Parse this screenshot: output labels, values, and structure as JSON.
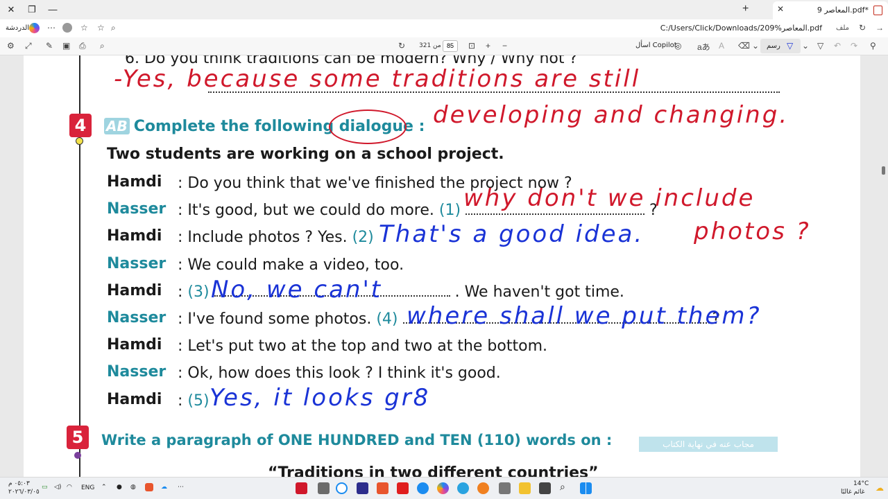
{
  "browser": {
    "tab_title": "المعاصر 9.pdf*",
    "address_label": "ملف",
    "url": "C:/Users/Click/Downloads/209%المعاصر.pdf",
    "chat_label": "الدردشة"
  },
  "pdf_toolbar": {
    "page_number": "85",
    "page_of": "من 321",
    "copilot_label": "اسأل Copilot",
    "draw_label": "رسم"
  },
  "document": {
    "top_question": "6. Do you think traditions can be modern? Why / Why not ?",
    "section4": {
      "number": "4",
      "ab_label": "AB",
      "heading": "Complete the following dialogue :",
      "intro": "Two students are working on a school project.",
      "lines": [
        {
          "speaker": "Hamdi",
          "text": ": Do you think that we've finished the project now ?"
        },
        {
          "speaker": "Nasser",
          "text": ": It's good, but we could do more.",
          "num": "(1)",
          "end": "?"
        },
        {
          "speaker": "Hamdi",
          "text": ": Include photos ? Yes.",
          "num": "(2)"
        },
        {
          "speaker": "Nasser",
          "text": ": We could make a video, too."
        },
        {
          "speaker": "Hamdi",
          "pre": ":",
          "num": "(3)",
          "text": ". We haven't got time."
        },
        {
          "speaker": "Nasser",
          "text": ": I've found some photos.",
          "num": "(4)",
          "end": "?"
        },
        {
          "speaker": "Hamdi",
          "text": ": Let's put two at the top and two at the bottom."
        },
        {
          "speaker": "Nasser",
          "text": ": Ok, how does this look ? I think it's good."
        },
        {
          "speaker": "Hamdi",
          "pre": ":",
          "num": "(5)"
        }
      ]
    },
    "section5": {
      "number": "5",
      "heading": "Write a paragraph of ONE HUNDRED and TEN (110) words on :",
      "tag": "مجاب عنه في نهاية الكتاب",
      "topic": "“Traditions in two different countries”"
    }
  },
  "handwriting": {
    "red_1": "-Yes, because some traditions are still",
    "red_2": "developing and changing.",
    "red_3": "why don't we include",
    "red_4": "photos ?",
    "blue_2": "That's a good idea.",
    "blue_3": "No, we can't",
    "blue_4": "where shall we put them?",
    "blue_5": "Yes, it looks gr8"
  },
  "taskbar": {
    "time": "٠٥:٠٣ م",
    "date": "٢٠٢٦/٠٣/٠٥",
    "lang": "ENG",
    "temp": "14°C",
    "weather": "غائم غالبًا"
  },
  "colors": {
    "accent_teal": "#1e8a9c",
    "section_red": "#d9233b",
    "ink_red": "#d0182b",
    "ink_blue": "#1a33d6"
  }
}
